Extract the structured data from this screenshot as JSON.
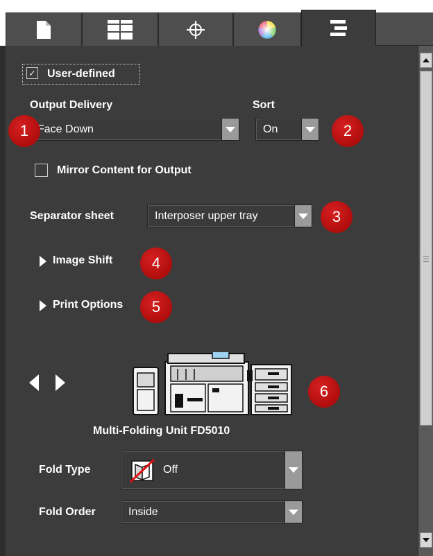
{
  "tabs": [
    {
      "icon": "document-icon",
      "active": false
    },
    {
      "icon": "layout-grid-icon",
      "active": false
    },
    {
      "icon": "crosshair-icon",
      "active": false
    },
    {
      "icon": "color-wheel-icon",
      "active": false
    },
    {
      "icon": "finishing-lines-icon",
      "active": true
    }
  ],
  "user_defined": {
    "label": "User-defined",
    "checked": true
  },
  "output_delivery": {
    "label": "Output Delivery",
    "value": "Face Down"
  },
  "sort": {
    "label": "Sort",
    "value": "On"
  },
  "mirror": {
    "label": "Mirror Content for Output",
    "checked": false
  },
  "separator": {
    "label": "Separator sheet",
    "value": "Interposer upper tray"
  },
  "image_shift": {
    "label": "Image Shift"
  },
  "print_options": {
    "label": "Print Options"
  },
  "device": {
    "name": "Multi-Folding Unit FD5010"
  },
  "fold_type": {
    "label": "Fold Type",
    "value": "Off"
  },
  "fold_order": {
    "label": "Fold Order",
    "value": "Inside"
  },
  "callouts": [
    "1",
    "2",
    "3",
    "4",
    "5",
    "6"
  ],
  "colors": {
    "panel": "#3c3c3c",
    "tab": "#4e4e4e",
    "badge": "#c01414",
    "scrollbar": "#cfcfcf"
  }
}
